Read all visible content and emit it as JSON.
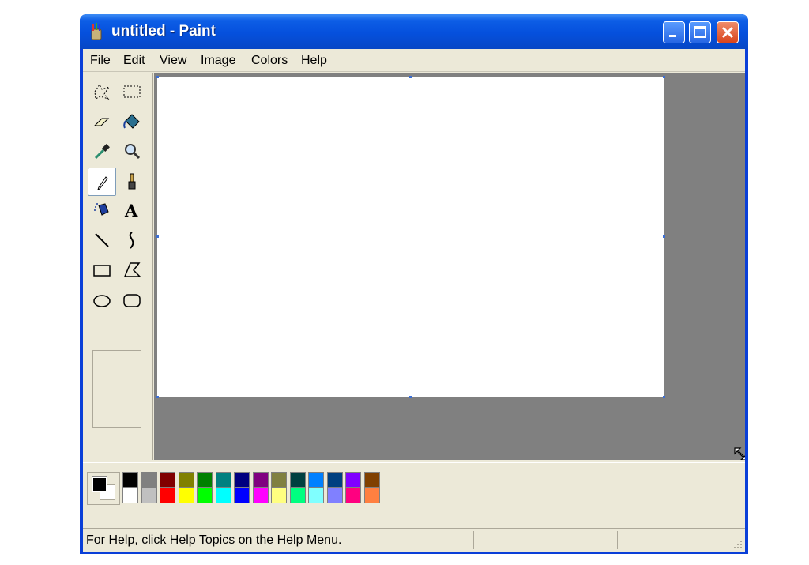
{
  "window": {
    "title": "untitled - Paint",
    "app_icon": "paint-app-icon"
  },
  "titlebar_buttons": [
    "minimize-icon",
    "maximize-icon",
    "close-icon"
  ],
  "menu": {
    "items": [
      "File",
      "Edit",
      "View",
      "Image",
      "Colors",
      "Help"
    ]
  },
  "tools": [
    {
      "name": "free-form-select",
      "icon": "free-form-select-icon"
    },
    {
      "name": "select",
      "icon": "rect-select-icon"
    },
    {
      "name": "eraser",
      "icon": "eraser-icon"
    },
    {
      "name": "fill-with-color",
      "icon": "paint-bucket-icon"
    },
    {
      "name": "pick-color",
      "icon": "eyedropper-icon"
    },
    {
      "name": "magnifier",
      "icon": "magnifier-icon"
    },
    {
      "name": "pencil",
      "icon": "pencil-icon",
      "selected": true
    },
    {
      "name": "brush",
      "icon": "brush-icon"
    },
    {
      "name": "airbrush",
      "icon": "airbrush-icon"
    },
    {
      "name": "text",
      "icon": "text-icon",
      "glyph": "A"
    },
    {
      "name": "line",
      "icon": "line-icon"
    },
    {
      "name": "curve",
      "icon": "curve-icon"
    },
    {
      "name": "rectangle",
      "icon": "rectangle-icon"
    },
    {
      "name": "polygon",
      "icon": "polygon-icon"
    },
    {
      "name": "ellipse",
      "icon": "ellipse-icon"
    },
    {
      "name": "rounded-rectangle",
      "icon": "rounded-rectangle-icon"
    }
  ],
  "current_colors": {
    "foreground": "#000000",
    "background": "#ffffff"
  },
  "palette": {
    "row1": [
      "#000000",
      "#808080",
      "#800000",
      "#808000",
      "#008000",
      "#008080",
      "#000080",
      "#800080",
      "#808040",
      "#004040",
      "#0080ff",
      "#004080",
      "#8000ff",
      "#804000"
    ],
    "row2": [
      "#ffffff",
      "#c0c0c0",
      "#ff0000",
      "#ffff00",
      "#00ff00",
      "#00ffff",
      "#0000ff",
      "#ff00ff",
      "#ffff80",
      "#00ff80",
      "#80ffff",
      "#8080ff",
      "#ff0080",
      "#ff8040"
    ]
  },
  "statusbar": {
    "text": "For Help, click Help Topics on the Help Menu."
  },
  "colors": {
    "titlebar": "#0550dd",
    "workspace": "#808080",
    "canvas": "#ffffff",
    "chrome": "#ece9d8"
  }
}
